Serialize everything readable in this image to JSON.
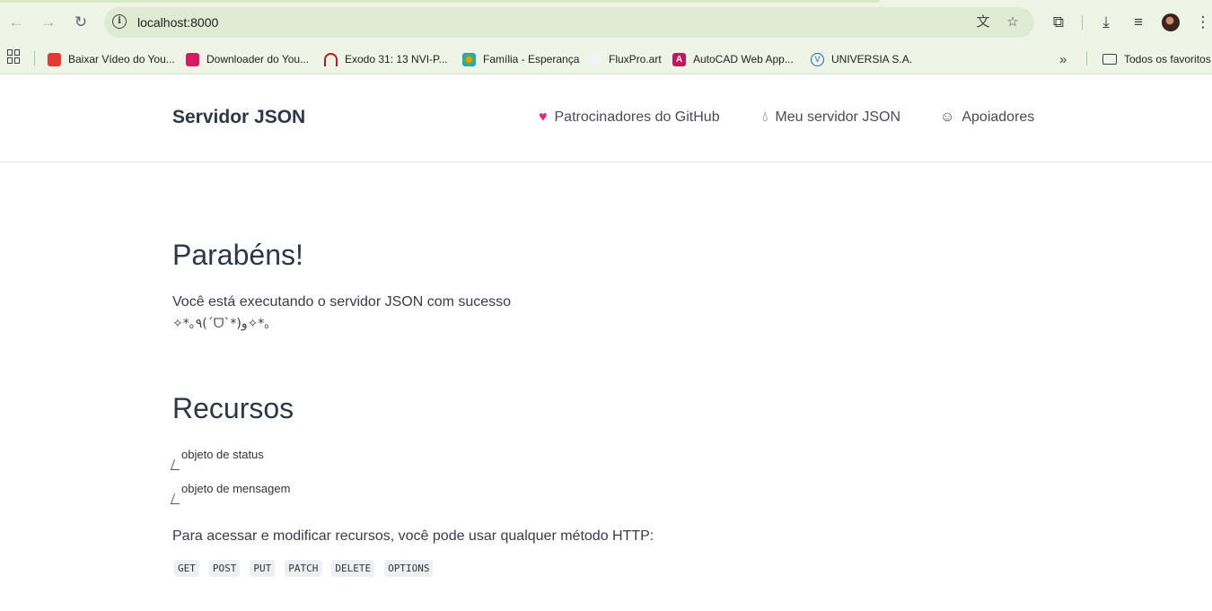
{
  "browser": {
    "url": "localhost:8000",
    "bookmarks": [
      {
        "label": "Baixar Vídeo do You...",
        "color": "#e53935"
      },
      {
        "label": "Downloader do You...",
        "color": "#d81b60"
      },
      {
        "label": "Exodo 31: 13 NVI-P...",
        "color": "#b71c1c"
      },
      {
        "label": "Família - Esperança",
        "color": "#4caf50"
      },
      {
        "label": "FluxPro.art",
        "color": "#e0e0e0"
      },
      {
        "label": "AutoCAD Web App...",
        "color": "#c2185b"
      },
      {
        "label": "UNIVERSIA S.A.",
        "color": "#1565c0"
      }
    ],
    "all_bookmarks_label": "Todos os favoritos"
  },
  "header": {
    "brand": "Servidor JSON",
    "nav": [
      {
        "label": "Patrocinadores do GitHub",
        "icon": "heart-icon",
        "color": "#ea1e8c"
      },
      {
        "label": "Meu servidor JSON",
        "icon": "droplet-icon",
        "color": "#3c4a5c"
      },
      {
        "label": "Apoiadores",
        "icon": "smiley-icon",
        "color": "#3c4a5c"
      }
    ]
  },
  "main": {
    "congrats_title": "Parabéns!",
    "congrats_text": "Você está executando o servidor JSON com sucesso",
    "kaomoji": "✧*｡٩(ˊᗜˋ*)و✧*｡",
    "resources_title": "Recursos",
    "resources": [
      "objeto de status",
      "objeto de mensagem"
    ],
    "http_text": "Para acessar e modificar recursos, você pode usar qualquer método HTTP:",
    "methods": [
      "GET",
      "POST",
      "PUT",
      "PATCH",
      "DELETE",
      "OPTIONS"
    ]
  }
}
